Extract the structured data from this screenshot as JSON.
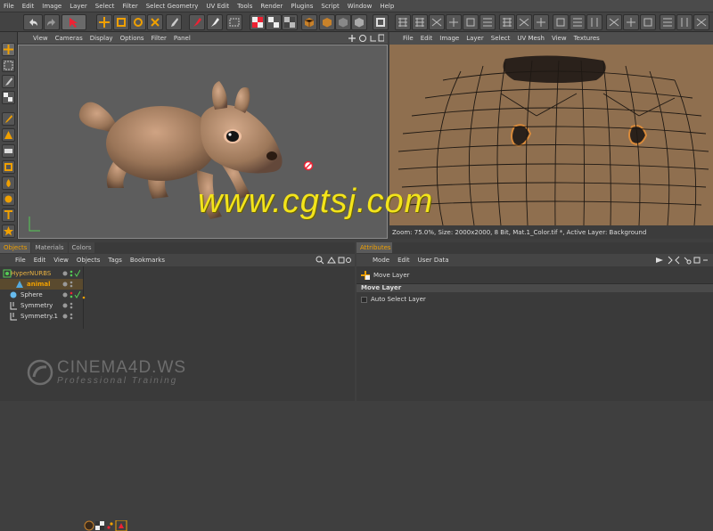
{
  "menubar": [
    "File",
    "Edit",
    "Image",
    "Layer",
    "Select",
    "Filter",
    "Select Geometry",
    "UV Edit",
    "Tools",
    "Render",
    "Plugins",
    "Script",
    "Window",
    "Help"
  ],
  "viewport": {
    "menu": [
      "View",
      "Cameras",
      "Display",
      "Options",
      "Filter",
      "Panel"
    ]
  },
  "uv_editor": {
    "menu": [
      "File",
      "Edit",
      "Image",
      "Layer",
      "Select",
      "UV Mesh",
      "View",
      "Textures"
    ],
    "status": "Zoom: 75.0%, Size: 2000x2000, 8 Bit, Mat.1_Color.tif *, Active Layer: Background"
  },
  "watermark": "www.cgtsj.com",
  "object_manager": {
    "tabs": [
      "Objects",
      "Materials",
      "Colors"
    ],
    "menu": [
      "File",
      "Edit",
      "View",
      "Objects",
      "Tags",
      "Bookmarks"
    ],
    "objects": [
      {
        "name": "HyperNURBS",
        "color": "#e8b040"
      },
      {
        "name": "animal",
        "color": "#f0a000"
      },
      {
        "name": "Sphere",
        "color": "#dddddd"
      },
      {
        "name": "Symmetry",
        "color": "#dddddd"
      },
      {
        "name": "Symmetry.1",
        "color": "#dddddd"
      }
    ]
  },
  "attribute_manager": {
    "tab": "Attributes",
    "menu": [
      "Mode",
      "Edit",
      "User Data"
    ],
    "tool_title": "Move Layer",
    "section": "Move Layer",
    "option_label": "Auto Select Layer",
    "option_checked": false
  },
  "logo": {
    "line1": "CINEMA4D.WS",
    "line2": "Professional Training"
  },
  "colors": {
    "accent": "#f0a000",
    "selected_row": "#5a4a2e",
    "texture_bg": "#8b6b4a",
    "watermark": "#f3e41b"
  }
}
